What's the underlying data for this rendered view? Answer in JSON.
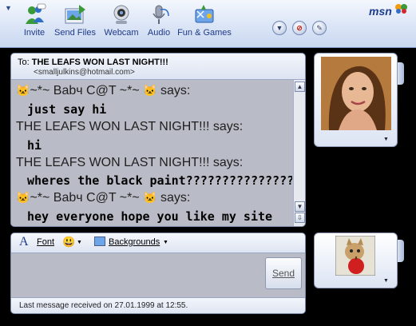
{
  "toolbar": {
    "buttons": [
      {
        "id": "invite",
        "label": "Invite"
      },
      {
        "id": "send-files",
        "label": "Send Files"
      },
      {
        "id": "webcam",
        "label": "Webcam"
      },
      {
        "id": "audio",
        "label": "Audio"
      },
      {
        "id": "fun-games",
        "label": "Fun & Games"
      }
    ],
    "logo_text": "msn"
  },
  "conversation": {
    "to_prefix": "To:",
    "to_name": "THE LEAFS WON LAST NIGHT!!!",
    "to_email": "<smalljulkins@hotmail.com>",
    "history": [
      {
        "kind": "says",
        "text": "~*~ Babч C@T ~*~",
        "cats": true
      },
      {
        "kind": "msg",
        "text": "just say hi",
        "color": "#d400d4"
      },
      {
        "kind": "says",
        "text": "THE LEAFS WON LAST NIGHT!!! says:",
        "cats": false
      },
      {
        "kind": "msg",
        "text": "hi",
        "color": "#00c400"
      },
      {
        "kind": "says",
        "text": "THE LEAFS WON LAST NIGHT!!! says:",
        "cats": false
      },
      {
        "kind": "msg",
        "text": "wheres the black paint?????????????????",
        "color": "#00c400"
      },
      {
        "kind": "says",
        "text": "~*~ Babч C@T ~*~",
        "cats": true
      },
      {
        "kind": "msg",
        "text": "hey everyone hope you like my site",
        "color": "#d400d4"
      }
    ],
    "says_suffix": "says:"
  },
  "compose": {
    "font_label": "Font",
    "backgrounds_label": "Backgrounds",
    "send_label": "Send",
    "status": "Last message received on 27.01.1999 at 12:55."
  },
  "colors": {
    "accent": "#1e3a8a",
    "pink": "#d400d4",
    "green": "#00c400"
  }
}
